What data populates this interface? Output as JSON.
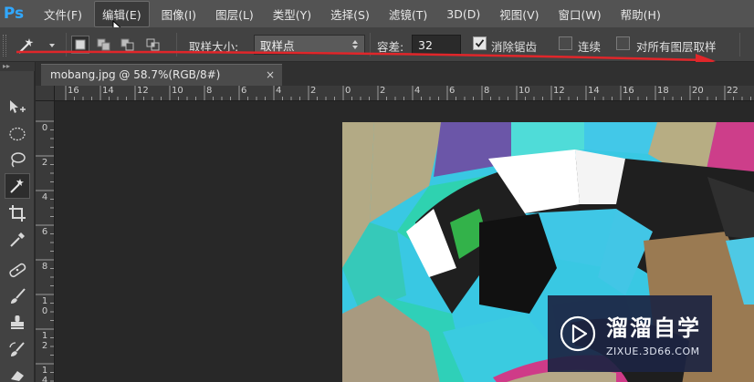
{
  "app": {
    "logo_text": "Ps"
  },
  "menu": {
    "items": [
      {
        "label": "文件(F)"
      },
      {
        "label": "编辑(E)",
        "active": true
      },
      {
        "label": "图像(I)"
      },
      {
        "label": "图层(L)"
      },
      {
        "label": "类型(Y)"
      },
      {
        "label": "选择(S)"
      },
      {
        "label": "滤镜(T)"
      },
      {
        "label": "3D(D)"
      },
      {
        "label": "视图(V)"
      },
      {
        "label": "窗口(W)"
      },
      {
        "label": "帮助(H)"
      }
    ]
  },
  "options": {
    "sample_size_label": "取样大小:",
    "sample_size_value": "取样点",
    "tolerance_label": "容差:",
    "tolerance_value": "32",
    "antialias_label": "消除锯齿",
    "antialias_checked": true,
    "contiguous_label": "连续",
    "contiguous_checked": false,
    "all_layers_label": "对所有图层取样",
    "all_layers_checked": false
  },
  "document": {
    "tab_title": "mobang.jpg @ 58.7%(RGB/8#)",
    "close_glyph": "×"
  },
  "rulers": {
    "horizontal": [
      "16",
      "14",
      "12",
      "10",
      "8",
      "6",
      "4",
      "2",
      "0",
      "2",
      "4",
      "6",
      "8",
      "10",
      "12",
      "14",
      "16",
      "18",
      "20",
      "22"
    ],
    "vertical": [
      "0",
      "2",
      "4",
      "6",
      "8",
      "10",
      "12",
      "14"
    ]
  },
  "tools": [
    {
      "name": "move-tool",
      "icon": "move-icon"
    },
    {
      "name": "marquee-tool",
      "icon": "ellipse-marquee-icon"
    },
    {
      "name": "lasso-tool",
      "icon": "lasso-icon"
    },
    {
      "name": "magic-wand-tool",
      "icon": "magic-wand-icon",
      "active": true
    },
    {
      "name": "crop-tool",
      "icon": "crop-icon"
    },
    {
      "name": "eyedropper-tool",
      "icon": "eyedropper-icon"
    },
    {
      "name": "healing-brush-tool",
      "icon": "bandage-icon"
    },
    {
      "name": "brush-tool",
      "icon": "brush-icon"
    },
    {
      "name": "clone-stamp-tool",
      "icon": "stamp-icon"
    },
    {
      "name": "history-brush-tool",
      "icon": "history-brush-icon"
    },
    {
      "name": "eraser-tool",
      "icon": "eraser-icon"
    }
  ],
  "watermark": {
    "title": "溜溜自学",
    "url": "ZIXUE.3D66.COM"
  },
  "colors": {
    "annotation_red": "#e0262a",
    "ps_blue": "#31a8ff"
  }
}
